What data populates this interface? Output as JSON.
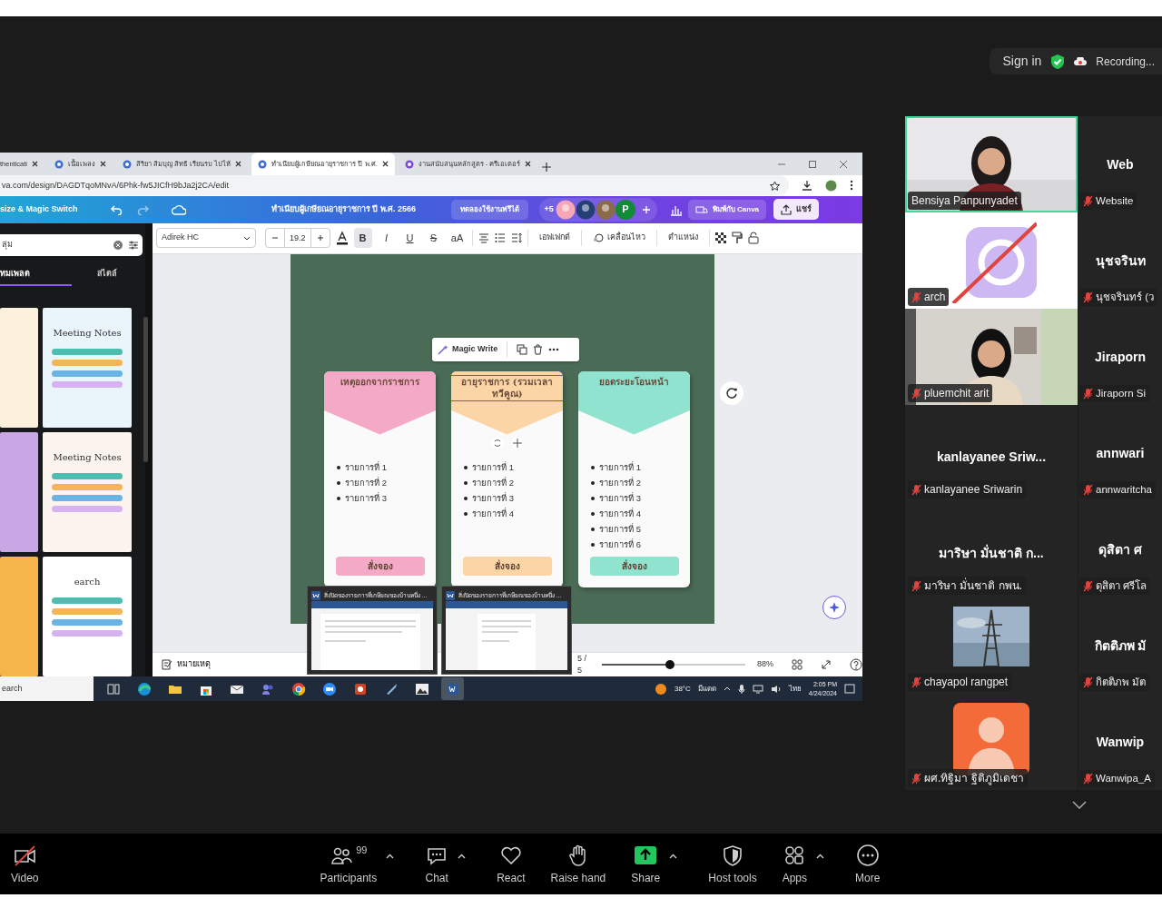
{
  "meeting_bar": {
    "sign_in": "Sign in",
    "recording": "Recording..."
  },
  "shared_screen": {
    "browser": {
      "tabs": [
        {
          "title": "thenticati",
          "selected": false
        },
        {
          "title": "เนื้อเพลง",
          "selected": false
        },
        {
          "title": "สิริยา สิมบุญ สิทธิ เรียนรบ ไปให้",
          "selected": false
        },
        {
          "title": "ทำเนียบผู้เกษียณอายุราชการ ปี พ.ศ.",
          "selected": true
        },
        {
          "title": "งานสนับสนุนหลักสูตร - ครีเอเตอร์",
          "selected": false
        }
      ],
      "address": "va.com/design/DAGDTqoMNvA/6Phk-fw5JICfH9bJa2j2CA/edit"
    },
    "canva_header": {
      "resize": "size & Magic Switch",
      "title": "ทำเนียบผู้เกษียณอายุราชการ ปี พ.ศ. 2566",
      "trial": "ทดลองใช้งานฟรีได้",
      "more_collaborators": "+5",
      "collaborator_initial": "P",
      "print": "พิมพ์กับ Canva",
      "share": "แชร์"
    },
    "side_panel": {
      "search": "ลุ่ม",
      "tabs": [
        {
          "label": "ทมเพลต",
          "selected": true
        },
        {
          "label": "สไตล์",
          "selected": false
        }
      ],
      "templates": [
        {
          "color": "#fbf1dc"
        },
        {
          "color": "#eaf4fb",
          "title": "Meeting Notes"
        },
        {
          "color": "#c9a6e4"
        },
        {
          "color": "#fbf3ee",
          "title": "Meeting Notes"
        },
        {
          "color": "#f6b54a"
        },
        {
          "color": "#ffffff",
          "title": "earch"
        }
      ]
    },
    "text_toolbar": {
      "font": "Adirek HC",
      "size": "19.2",
      "format": [
        {
          "label": "B",
          "on": true
        },
        {
          "label": "I",
          "on": false
        },
        {
          "label": "U",
          "on": false
        },
        {
          "label": "S",
          "on": false
        },
        {
          "label": "aA",
          "on": false
        }
      ],
      "actions": [
        "เอฟเฟกต์",
        "เคลื่อนไหว",
        "ตำแหน่ง"
      ]
    },
    "canvas": {
      "magic_write": "Magic Write",
      "cards": [
        {
          "title": "เหตุออกจากราชการ",
          "color": "#f4a9c6",
          "selected": false,
          "items": [
            "รายการที่ 1",
            "รายการที่ 2",
            "รายการที่ 3"
          ],
          "button": "สั่งจอง"
        },
        {
          "title": "อายุราชการ (รวมเวลาทวีคูณ)",
          "color": "#fbd5a6",
          "selected": true,
          "items": [
            "รายการที่ 1",
            "รายการที่ 2",
            "รายการที่ 3",
            "รายการที่ 4"
          ],
          "button": "สั่งจอง"
        },
        {
          "title": "ยอดระยะโอนหน้า",
          "color": "#8fe3cf",
          "selected": false,
          "items": [
            "รายการที่ 1",
            "รายการที่ 2",
            "รายการที่ 3",
            "รายการที่ 4",
            "รายการที่ 5",
            "รายการที่ 6"
          ],
          "button": "สั่งจอง"
        }
      ]
    },
    "bottom_bar": {
      "notes": "หมายเหตุ",
      "page": "5 / 5",
      "zoom": {
        "level": 0.47,
        "reading": "88%"
      }
    },
    "previews": [
      {
        "title": "สิ่งปิดของรายการที่เกษียณของบ้านหนึ่ง ..."
      },
      {
        "title": "สิ่งปิดของรายการที่เกษียณของบ้านหนึ่ง ..."
      }
    ],
    "taskbar": {
      "search": "earch",
      "apps": [
        {
          "kind": "taskview",
          "active": false
        },
        {
          "kind": "edge",
          "active": false
        },
        {
          "kind": "folder",
          "active": false
        },
        {
          "kind": "store",
          "active": false
        },
        {
          "kind": "mail",
          "active": false
        },
        {
          "kind": "teams",
          "active": false
        },
        {
          "kind": "chrome",
          "active": false
        },
        {
          "kind": "zoom",
          "active": false
        },
        {
          "kind": "powerpoint",
          "active": false
        },
        {
          "kind": "tool",
          "active": false
        },
        {
          "kind": "photos",
          "active": false
        },
        {
          "kind": "word",
          "active": true
        }
      ],
      "temperature": "38°C",
      "weather": "มีแดด",
      "language": "ไทย",
      "time": "2:05 PM",
      "date": "4/24/2024"
    }
  },
  "gallery": [
    {
      "kind": "video",
      "label": "Bensiya Panpunyadet",
      "muted": false,
      "speaking": true
    },
    {
      "kind": "name",
      "name": "Web",
      "label": "Website",
      "muted": true,
      "speaking": false
    },
    {
      "kind": "app_icon",
      "label": "arch",
      "muted": true,
      "speaking": false
    },
    {
      "kind": "name",
      "name": "นุชจรินท",
      "label": "นุชจรินทร์ (ว",
      "muted": true,
      "speaking": false
    },
    {
      "kind": "video",
      "label": "pluemchit arit",
      "muted": true,
      "speaking": false
    },
    {
      "kind": "name",
      "name": "Jiraporn",
      "label": "Jiraporn Si",
      "muted": true,
      "speaking": false
    },
    {
      "kind": "name",
      "name": "kanlayanee  Sriw...",
      "label": "kanlayanee Sriwarin",
      "muted": true,
      "speaking": false
    },
    {
      "kind": "name",
      "name": "annwari",
      "label": "annwaritcha",
      "muted": true,
      "speaking": false
    },
    {
      "kind": "name",
      "name": "มาริษา มั่นชาติ ก...",
      "label": "มาริษา มั่นชาติ กพน.",
      "muted": true,
      "speaking": false
    },
    {
      "kind": "name",
      "name": "ดุสิตา ศ",
      "label": "ดุสิตา ศรีโล",
      "muted": true,
      "speaking": false
    },
    {
      "label": "chayapol rangpet",
      "muted": true,
      "speaking": false
    },
    {
      "kind": "name",
      "name": "กิตติภพ มั",
      "label": "กิตติภพ มัต",
      "muted": true,
      "speaking": false
    },
    {
      "kind": "avatar",
      "label": "ผศ.ทิฐิมา ฐิติภูมิเดชา",
      "muted": true,
      "speaking": false
    },
    {
      "kind": "name",
      "name": "Wanwip",
      "label": "Wanwipa_A",
      "muted": true,
      "speaking": false
    }
  ],
  "toolbar": [
    {
      "kind": "video",
      "label": "Video",
      "off": true,
      "caret": false
    },
    {
      "kind": "participants",
      "label": "Participants",
      "count": "99",
      "caret": true
    },
    {
      "kind": "chat",
      "label": "Chat",
      "caret": true
    },
    {
      "kind": "react",
      "label": "React",
      "caret": false
    },
    {
      "kind": "raise",
      "label": "Raise hand",
      "caret": false
    },
    {
      "kind": "share",
      "label": "Share",
      "caret": true
    },
    {
      "kind": "host",
      "label": "Host tools",
      "caret": false
    },
    {
      "kind": "apps",
      "label": "Apps",
      "caret": true
    },
    {
      "kind": "more",
      "label": "More",
      "caret": false
    }
  ]
}
